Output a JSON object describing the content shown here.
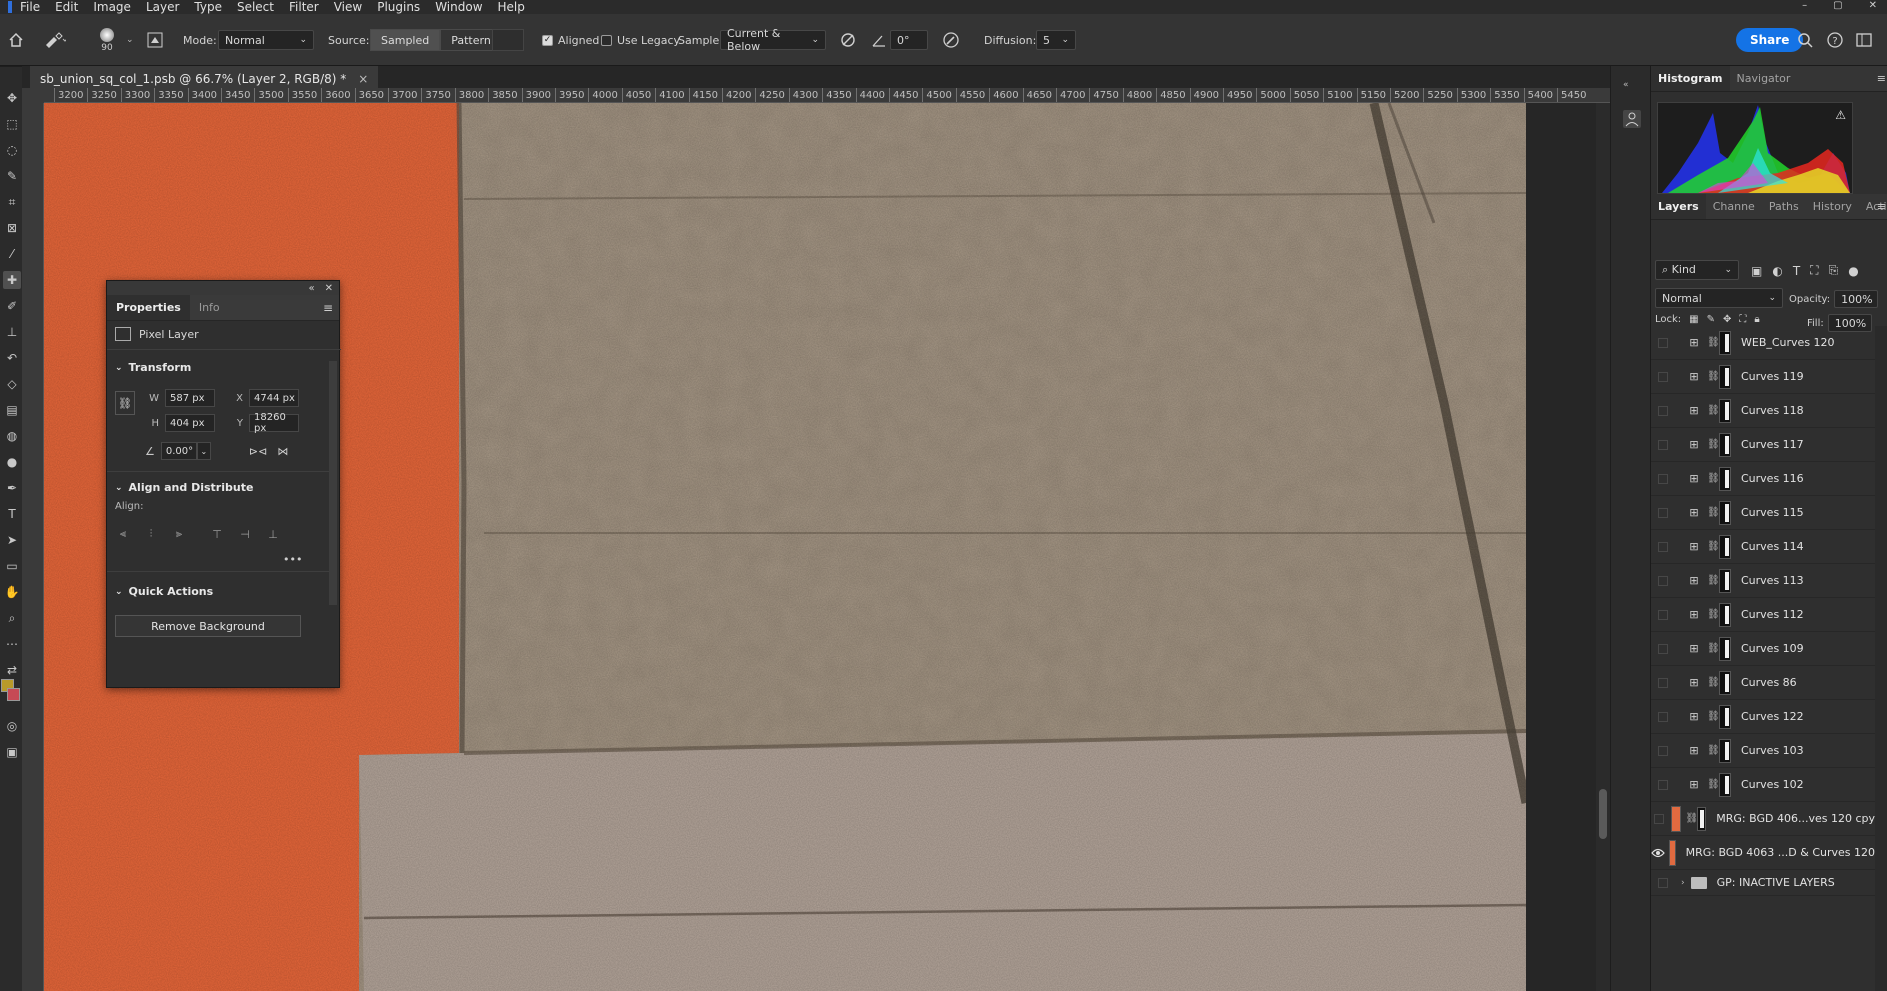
{
  "menu": [
    "File",
    "Edit",
    "Image",
    "Layer",
    "Type",
    "Select",
    "Filter",
    "View",
    "Plugins",
    "Window",
    "Help"
  ],
  "window_controls": [
    "–",
    "▢",
    "✕"
  ],
  "options": {
    "brush_size": "90",
    "mode_label": "Mode:",
    "mode_value": "Normal",
    "source_label": "Source:",
    "source_sampled": "Sampled",
    "source_pattern": "Pattern",
    "aligned_label": "Aligned",
    "legacy_label": "Use Legacy",
    "sample_label": "Sample:",
    "sample_value": "Current & Below",
    "angle_value": "0°",
    "diffusion_label": "Diffusion:",
    "diffusion_value": "5",
    "share_label": "Share"
  },
  "document": {
    "tab_title": "sb_union_sq_col_1.psb @ 66.7% (Layer 2, RGB/8) *",
    "close": "×"
  },
  "ruler": [
    "3200",
    "3250",
    "3300",
    "3350",
    "3400",
    "3450",
    "3500",
    "3550",
    "3600",
    "3650",
    "3700",
    "3750",
    "3800",
    "3850",
    "3900",
    "3950",
    "4000",
    "4050",
    "4100",
    "4150",
    "4200",
    "4250",
    "4300",
    "4350",
    "4400",
    "4450",
    "4500",
    "4550",
    "4600",
    "4650",
    "4700",
    "4750",
    "4800",
    "4850",
    "4900",
    "4950",
    "5000",
    "5050",
    "5100",
    "5150",
    "5200",
    "5250",
    "5300",
    "5350",
    "5400",
    "5450"
  ],
  "properties": {
    "tab_properties": "Properties",
    "tab_info": "Info",
    "layer_type": "Pixel Layer",
    "transform_title": "Transform",
    "w_label": "W",
    "w_value": "587 px",
    "h_label": "H",
    "h_value": "404 px",
    "x_label": "X",
    "x_value": "4744 px",
    "y_label": "Y",
    "y_value": "18260 px",
    "angle_value": "0.00°",
    "align_title": "Align and Distribute",
    "align_label": "Align:",
    "more": "•••",
    "quick_title": "Quick Actions",
    "remove_bg": "Remove Background"
  },
  "top_panel": {
    "tab_histogram": "Histogram",
    "tab_navigator": "Navigator"
  },
  "layers_panel": {
    "tabs": [
      "Layers",
      "Channe",
      "Paths",
      "History",
      "Action"
    ],
    "kind_label": "Kind",
    "blend_mode": "Normal",
    "opacity_label": "Opacity:",
    "opacity_value": "100%",
    "lock_label": "Lock:",
    "fill_label": "Fill:",
    "fill_value": "100%",
    "layers": [
      {
        "name": "WEB_Curves 120",
        "type": "adjustment",
        "visible": false
      },
      {
        "name": "Curves 119",
        "type": "adjustment",
        "visible": false
      },
      {
        "name": "Curves 118",
        "type": "adjustment",
        "visible": false
      },
      {
        "name": "Curves 117",
        "type": "adjustment",
        "visible": false
      },
      {
        "name": "Curves 116",
        "type": "adjustment",
        "visible": false
      },
      {
        "name": "Curves 115",
        "type": "adjustment",
        "visible": false
      },
      {
        "name": "Curves 114",
        "type": "adjustment",
        "visible": false
      },
      {
        "name": "Curves 113",
        "type": "adjustment",
        "visible": false
      },
      {
        "name": "Curves 112",
        "type": "adjustment",
        "visible": false
      },
      {
        "name": "Curves 109",
        "type": "adjustment",
        "visible": false
      },
      {
        "name": "Curves 86",
        "type": "adjustment",
        "visible": false
      },
      {
        "name": "Curves 122",
        "type": "adjustment",
        "visible": false
      },
      {
        "name": "Curves 103",
        "type": "adjustment",
        "visible": false
      },
      {
        "name": "Curves 102",
        "type": "adjustment",
        "visible": false
      },
      {
        "name": "MRG: BGD 406...ves 120 cpy",
        "type": "pixel-masked",
        "visible": false
      },
      {
        "name": "MRG: BGD 4063 ...D & Curves 120",
        "type": "pixel",
        "visible": true
      },
      {
        "name": "GP: INACTIVE LAYERS",
        "type": "group",
        "visible": false
      }
    ]
  },
  "colors": {
    "accent": "#1473e6",
    "canvas_orange": "#e8673a",
    "pavement": "#a99a88"
  }
}
